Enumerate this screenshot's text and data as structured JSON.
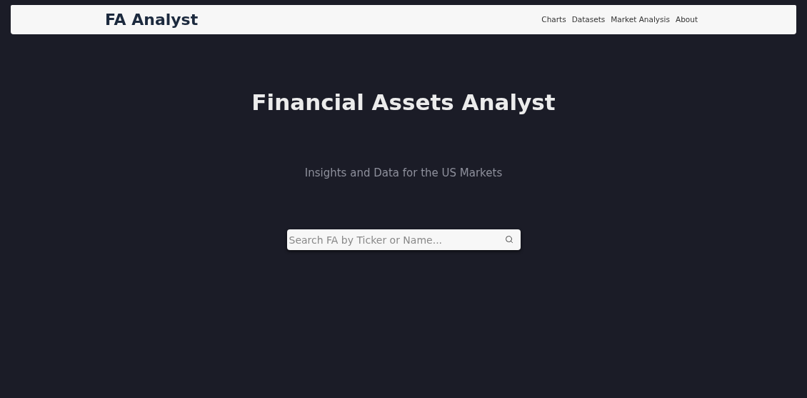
{
  "navbar": {
    "brand": "FA Analyst",
    "links": [
      "Charts",
      "Datasets",
      "Market Analysis",
      "About"
    ]
  },
  "hero": {
    "title": "Financial Assets Analyst",
    "subtitle": "Insights and Data for the US Markets"
  },
  "search": {
    "placeholder": "Search FA by Ticker or Name..."
  }
}
